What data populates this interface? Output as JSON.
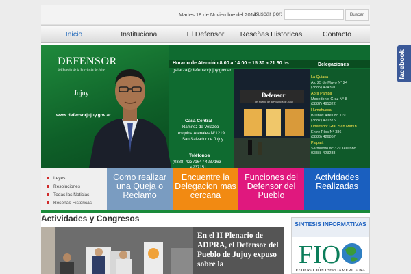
{
  "topbar": {
    "date": "Martes 18 de Noviembre del 2014",
    "search_label": "Buscar por:",
    "search_value": "",
    "search_button": "Buscar"
  },
  "nav": {
    "items": [
      {
        "label": "Inicio",
        "active": true
      },
      {
        "label": "Institucional"
      },
      {
        "label": "El Defensor"
      },
      {
        "label": "Reseñas Historicas"
      },
      {
        "label": "Contacto"
      }
    ]
  },
  "hero": {
    "logo_word": "DEFENSOR",
    "logo_sub": "del Pueblo de la Provincia de Jujuy",
    "province": "Jujuy",
    "url": "www.defensorjujuy.gov.ar",
    "hours": "Horario de Atención 8:00 a 14:00 – 15:30 a 21:30 hs",
    "email": "galarza@defensorjujuy.gov.ar",
    "casa_title": "Casa Central",
    "casa_lines": [
      "Ramirez de Velazco",
      "esquina Arenales N°1219",
      "San Salvador de Jujuy"
    ],
    "tel_title": "Teléfonos",
    "tel_lines": [
      "(0388) 4237164 / 4237163",
      "4237151"
    ],
    "deleg_title": "Delegaciones",
    "deleg_lines": [
      "La Quiaca",
      "Av. 25 de Mayo N° 24",
      "(3885) 424391",
      "Abra Pampa",
      "Macedonio Graz N° 8",
      "(3887) 491322",
      "Humahuaca",
      "Buenos Aires N° 119",
      "(3887) 421375",
      "Libertador Grál. San Martín",
      "Entre Ríos N° 386",
      "(3886) 426867",
      "Palpalá",
      "Sarmiento N° 329 Teléfono",
      "03888-423288"
    ],
    "building_sign": "Defensor",
    "building_sub": "del Pueblo de la Provincia de Jujuy"
  },
  "quicklinks": [
    "Leyes",
    "Resoluciones",
    "Todas las Noticias",
    "Reseñas Historicas"
  ],
  "tiles": {
    "queja": "Como realizar una Queja o Reclamo",
    "deleg": "Encuentre la Delegacion mas cercana",
    "func": "Funciones del Defensor del Pueblo",
    "act": "Actividades Realizadas"
  },
  "content": {
    "section_title": "Actividades y Congresos",
    "article_headline": "En el II Plenario de ADPRA, el Defensor del Pueblo de Jujuy expuso sobre la"
  },
  "sintesis": {
    "title": "SINTESIS INFORMATIVAS",
    "fio_letters": "FIO",
    "caption": "FEDERACIÓN IBEROAMERICANA"
  },
  "facebook": {
    "label": "facebook"
  },
  "colors": {
    "accent_green": "#1a8a3a",
    "nav_active": "#1863b8",
    "tile_queja": "#7a9cc1",
    "tile_deleg": "#f28a12",
    "tile_func": "#e0187e",
    "tile_act": "#1a5fbf",
    "facebook": "#3b5998"
  }
}
